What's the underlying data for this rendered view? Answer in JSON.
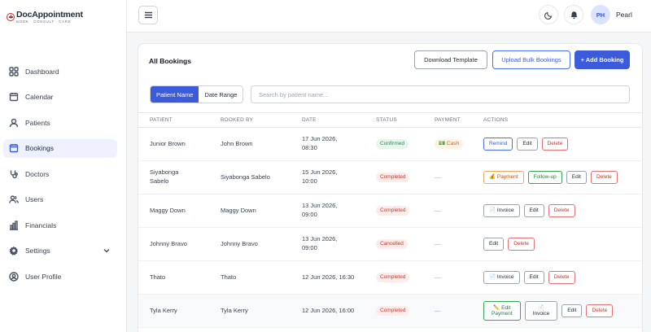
{
  "brand": {
    "name": "DocAppointment",
    "tagline": "BOOK · CONSULT · CARE"
  },
  "sidebar": {
    "items": [
      {
        "label": "Dashboard",
        "icon": "grid-icon",
        "active": false
      },
      {
        "label": "Calendar",
        "icon": "calendar-icon",
        "active": false
      },
      {
        "label": "Patients",
        "icon": "user-icon",
        "active": false
      },
      {
        "label": "Bookings",
        "icon": "calendar-check-icon",
        "active": true
      },
      {
        "label": "Doctors",
        "icon": "stethoscope-icon",
        "active": false
      },
      {
        "label": "Users",
        "icon": "users-icon",
        "active": false
      },
      {
        "label": "Financials",
        "icon": "bar-chart-icon",
        "active": false
      },
      {
        "label": "Settings",
        "icon": "gear-icon",
        "active": false,
        "expandable": true
      },
      {
        "label": "User Profile",
        "icon": "user-circle-icon",
        "active": false
      }
    ]
  },
  "header": {
    "avatar_initials": "PH",
    "user_name": "Pearl"
  },
  "bookings": {
    "title": "All Bookings",
    "buttons": {
      "download": "Download Template",
      "upload": "Upload Bulk Bookings",
      "add": "+ Add Booking"
    },
    "filter_tabs": [
      "Patient Name",
      "Date Range"
    ],
    "search_placeholder": "Search by patient name...",
    "columns": [
      "PATIENT",
      "BOOKED BY",
      "DATE",
      "STATUS",
      "PAYMENT",
      "ACTIONS"
    ],
    "rows": [
      {
        "patient": "Junior Brown",
        "booked_by": "John Brown",
        "date": "17 Jun 2026,",
        "time": "08:30",
        "status": "Confirmed",
        "payment": "💵 Cash",
        "actions": [
          "Remind",
          "Edit",
          "Delete"
        ]
      },
      {
        "patient": "Siyabonga",
        "patient2": "Sabelo",
        "booked_by": "Siyabonga Sabelo",
        "date": "15 Jun 2026,",
        "time": "10:00",
        "status": "Completed",
        "payment": "—",
        "actions": [
          "💰 Payment",
          "Follow-up",
          "Edit",
          "Delete"
        ]
      },
      {
        "patient": "Maggy Down",
        "booked_by": "Maggy Down",
        "date": "13 Jun 2026,",
        "time": "09:00",
        "status": "Completed",
        "payment": "—",
        "actions": [
          "📄 Invoice",
          "Edit",
          "Delete"
        ]
      },
      {
        "patient": "Johnny Bravo",
        "booked_by": "Johnny Bravo",
        "date": "13 Jun 2026,",
        "time": "09:00",
        "status": "Cancelled",
        "payment": "—",
        "actions": [
          "Edit",
          "Delete"
        ]
      },
      {
        "patient": "Thato",
        "booked_by": "Thato",
        "date": "12 Jun 2026, 16:30",
        "status": "Completed",
        "payment": "—",
        "actions": [
          "📄 Invoice",
          "Edit",
          "Delete"
        ]
      },
      {
        "patient": "Tyla Kerry",
        "booked_by": "Tyla Kerry",
        "date": "12 Jun 2026, 16:00",
        "status": "Completed",
        "payment": "—",
        "actions": [
          "✏️ Edit",
          "Payment",
          "📄",
          "Invoice",
          "Edit",
          "Delete"
        ]
      }
    ]
  },
  "colors": {
    "accent": "#3b5bdb",
    "danger": "#c0392b",
    "success": "#2f8a4f",
    "warning": "#c26a1b"
  }
}
